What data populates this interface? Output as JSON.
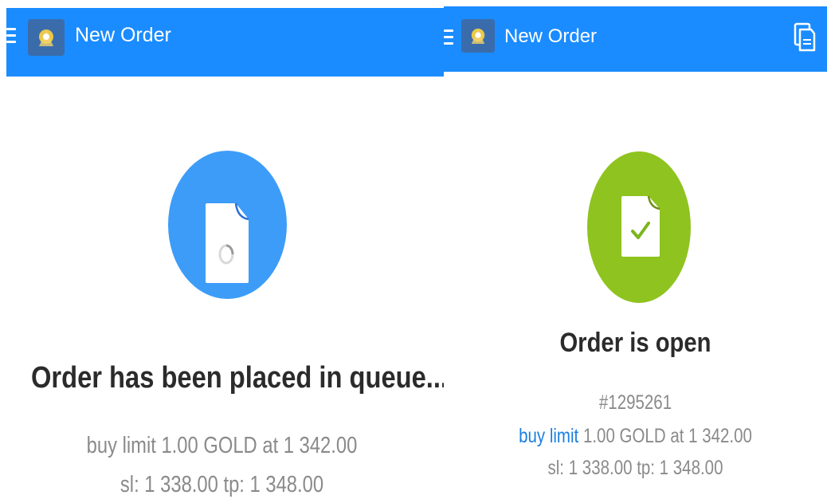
{
  "colors": {
    "appbar": "#1a8cff",
    "queue_circle": "#3d9cf8",
    "open_circle": "#8fc31f",
    "heading_text": "#2b2b2b",
    "detail_text": "#8a8a8a",
    "accent_text": "#1a7fe0"
  },
  "left_screen": {
    "appbar": {
      "menu_icon": "hamburger-menu-icon",
      "logo_icon": "app-logo-icon",
      "title": "New Order"
    },
    "status_icon": "document-pending-icon",
    "heading": "Order has been placed in queue...",
    "details": {
      "line1": "buy limit 1.00 GOLD at 1 342.00",
      "line2": "sl: 1 338.00 tp: 1 348.00"
    }
  },
  "right_screen": {
    "appbar": {
      "menu_icon": "hamburger-menu-icon",
      "logo_icon": "app-logo-icon",
      "title": "New Order",
      "action_icon": "documents-icon"
    },
    "status_icon": "document-check-icon",
    "heading": "Order is open",
    "details": {
      "ticket": "#1295261",
      "order_type": "buy limit",
      "line1_rest": " 1.00 GOLD at 1 342.00",
      "line2": "sl: 1 338.00 tp: 1 348.00"
    }
  }
}
